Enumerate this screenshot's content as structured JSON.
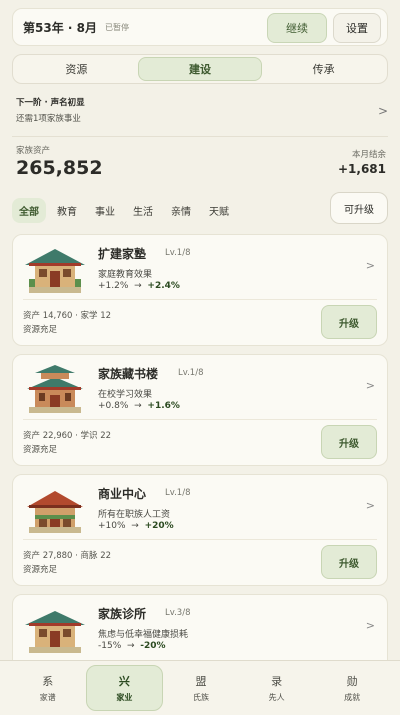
{
  "topbar": {
    "year_month": "第53年 · 8月",
    "paused": "已暂停",
    "continue": "继续",
    "settings": "设置"
  },
  "tabs": [
    {
      "label": "资源",
      "active": false
    },
    {
      "label": "建设",
      "active": true
    },
    {
      "label": "传承",
      "active": false
    }
  ],
  "next_stage": {
    "title": "下一阶 · 声名初显",
    "sub": "还需1项家族事业"
  },
  "assets": {
    "label": "家族资产",
    "value": "265,852",
    "month_label": "本月结余",
    "month_value": "+1,681"
  },
  "filters": [
    "全部",
    "教育",
    "事业",
    "生活",
    "亲情",
    "天赋"
  ],
  "filter_upgradable": "可升级",
  "cards": [
    {
      "name": "扩建家塾",
      "level": "Lv.1/8",
      "effect": "家庭教育效果",
      "from": "+1.2%",
      "arrow": "→",
      "to": "+2.4%",
      "cost": "资产 14,760 · 家学 12",
      "status": "资源充足",
      "button": "升级"
    },
    {
      "name": "家族藏书楼",
      "level": "Lv.1/8",
      "effect": "在校学习效果",
      "from": "+0.8%",
      "arrow": "→",
      "to": "+1.6%",
      "cost": "资产 22,960 · 学识 22",
      "status": "资源充足",
      "button": "升级"
    },
    {
      "name": "商业中心",
      "level": "Lv.1/8",
      "effect": "所有在职族人工资",
      "from": "+10%",
      "arrow": "→",
      "to": "+20%",
      "cost": "资产 27,880 · 商脉 22",
      "status": "资源充足",
      "button": "升级"
    },
    {
      "name": "家族诊所",
      "level": "Lv.3/8",
      "effect": "焦虑与低幸福健康损耗",
      "from": "-15%",
      "arrow": "→",
      "to": "-20%"
    }
  ],
  "nav": [
    {
      "icon": "系",
      "label": "家谱"
    },
    {
      "icon": "兴",
      "label": "家业"
    },
    {
      "icon": "盟",
      "label": "氏族"
    },
    {
      "icon": "录",
      "label": "先人"
    },
    {
      "icon": "勋",
      "label": "成就"
    }
  ],
  "colors": {
    "accent": "#e3ebd6",
    "accent_text": "#3e5a2f",
    "background": "#f3f1e7",
    "card": "#fbfaf4"
  }
}
